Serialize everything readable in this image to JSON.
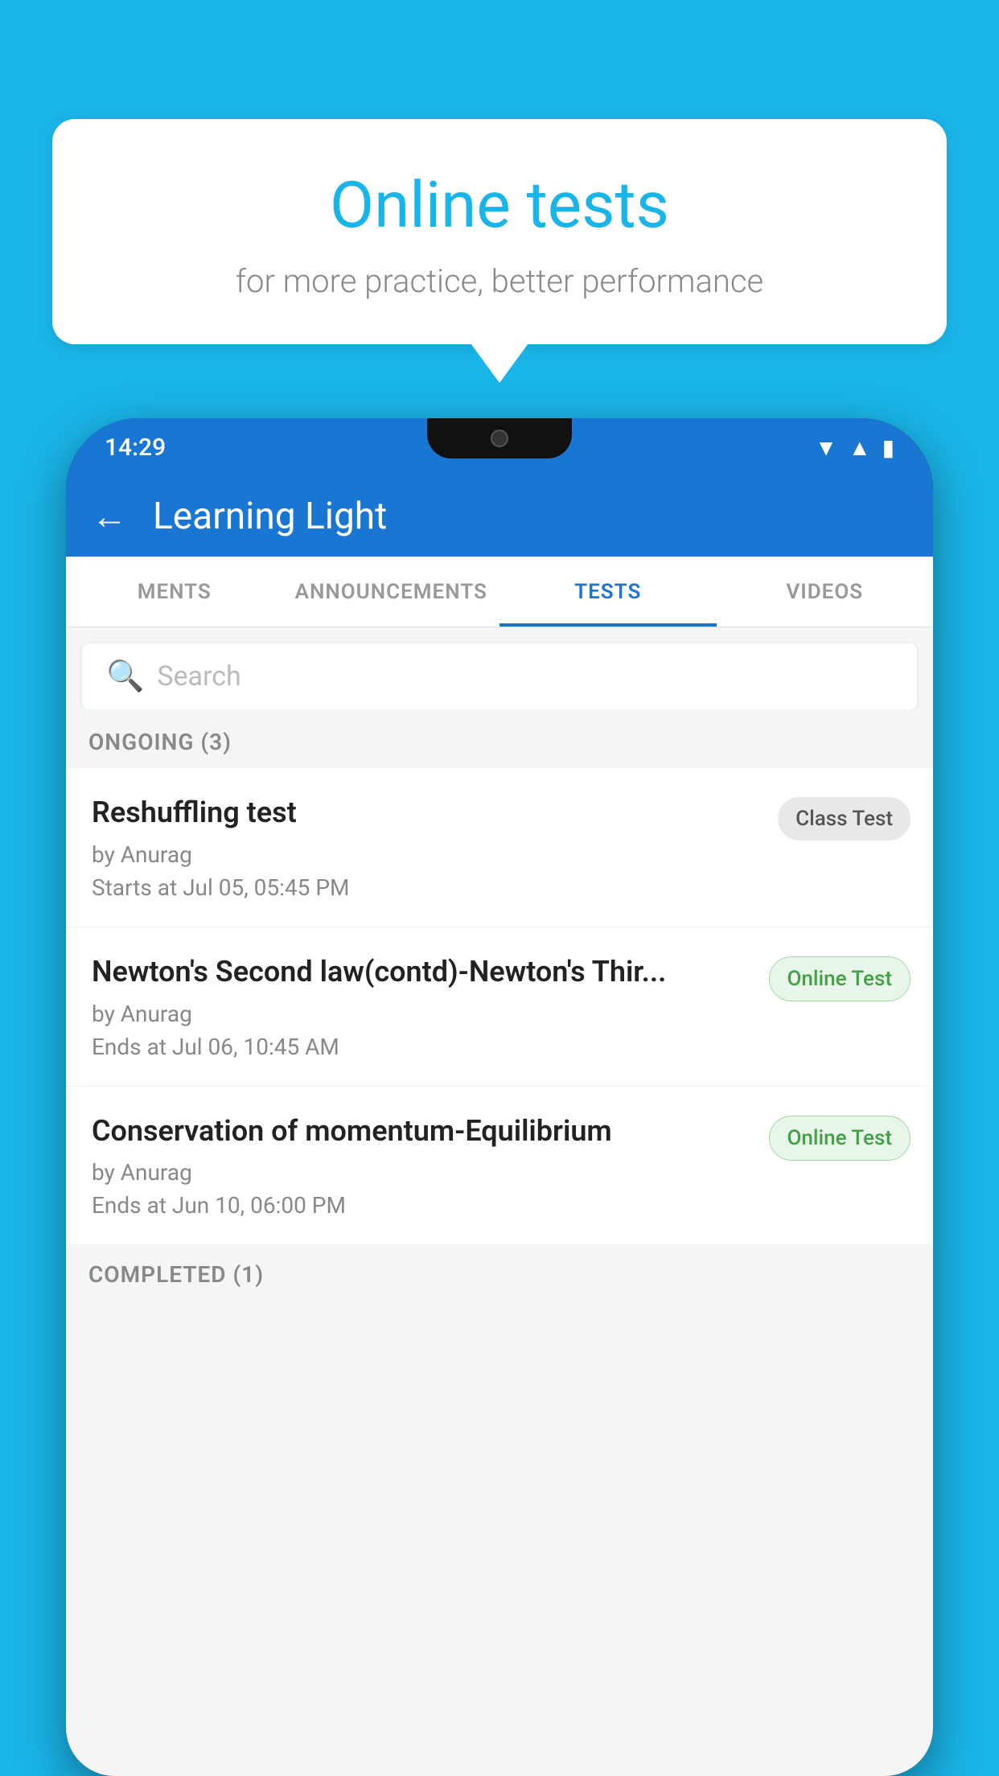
{
  "background_color": "#1ab5e8",
  "bubble": {
    "title": "Online tests",
    "subtitle": "for more practice, better performance"
  },
  "phone": {
    "status_bar": {
      "time": "14:29",
      "icons": [
        "wifi",
        "signal",
        "battery"
      ]
    },
    "app_bar": {
      "back_label": "←",
      "title": "Learning Light"
    },
    "tabs": [
      {
        "label": "MENTS",
        "active": false
      },
      {
        "label": "ANNOUNCEMENTS",
        "active": false
      },
      {
        "label": "TESTS",
        "active": true
      },
      {
        "label": "VIDEOS",
        "active": false
      }
    ],
    "search": {
      "placeholder": "Search"
    },
    "sections": [
      {
        "header": "ONGOING (3)",
        "tests": [
          {
            "name": "Reshuffling test",
            "by": "by Anurag",
            "date": "Starts at  Jul 05, 05:45 PM",
            "badge": "Class Test",
            "badge_type": "class"
          },
          {
            "name": "Newton's Second law(contd)-Newton's Thir...",
            "by": "by Anurag",
            "date": "Ends at  Jul 06, 10:45 AM",
            "badge": "Online Test",
            "badge_type": "online"
          },
          {
            "name": "Conservation of momentum-Equilibrium",
            "by": "by Anurag",
            "date": "Ends at  Jun 10, 06:00 PM",
            "badge": "Online Test",
            "badge_type": "online"
          }
        ]
      },
      {
        "header": "COMPLETED (1)",
        "tests": []
      }
    ]
  }
}
